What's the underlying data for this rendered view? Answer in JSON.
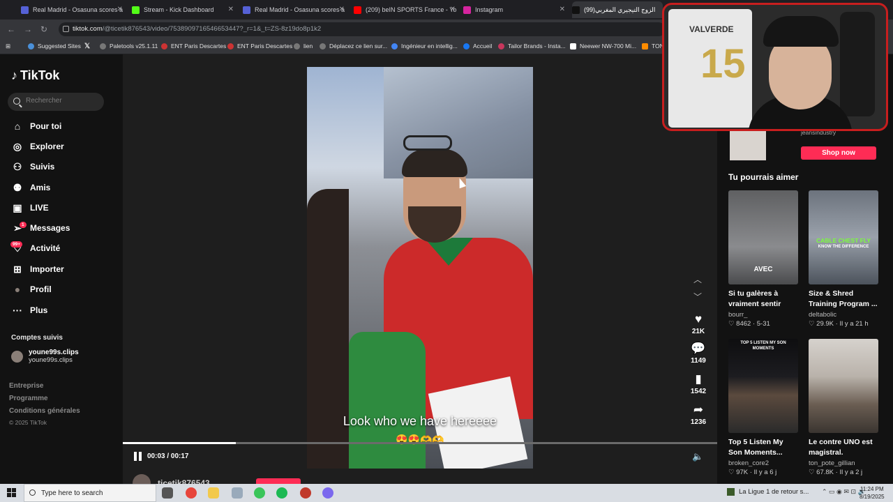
{
  "browser": {
    "tabs": [
      {
        "title": "Real Madrid - Osasuna scores a",
        "color": "#5561d6"
      },
      {
        "title": "Stream - Kick Dashboard",
        "color": "#53fc18"
      },
      {
        "title": "Real Madrid - Osasuna scores a",
        "color": "#5561d6"
      },
      {
        "title": "(209) beIN SPORTS France - Yo",
        "color": "#ff0000"
      },
      {
        "title": "Instagram",
        "color": "#d6249f"
      },
      {
        "title": "(99)الزوج التيجيري المغربي",
        "color": "#111111"
      }
    ],
    "url_host": "tiktok.com",
    "url_path": "/@ticetik876543/video/7538909716546653447?_r=1&_t=ZS-8z19do8p1k2",
    "bookmarks": [
      "Suggested Sites",
      "",
      "Paletools v25.1.11",
      "ENT Paris Descartes",
      "ENT Paris Descartes",
      "lien",
      "Déplacez ce lien sur...",
      "Ingénieur en intellig...",
      "Accueil",
      "Tailor Brands - Insta...",
      "Neewer NW-700 Mi...",
      "TON"
    ]
  },
  "sidebar": {
    "logo": "TikTok",
    "search_placeholder": "Rechercher",
    "nav": [
      {
        "label": "Pour toi",
        "icon": "home-icon",
        "glyph": "⌂"
      },
      {
        "label": "Explorer",
        "icon": "compass-icon",
        "glyph": "◎"
      },
      {
        "label": "Suivis",
        "icon": "following-icon",
        "glyph": "⚇"
      },
      {
        "label": "Amis",
        "icon": "friends-icon",
        "glyph": "⚉"
      },
      {
        "label": "LIVE",
        "icon": "live-icon",
        "glyph": "▣"
      },
      {
        "label": "Messages",
        "icon": "messages-icon",
        "glyph": "➢",
        "badge": "1"
      },
      {
        "label": "Activité",
        "icon": "activity-icon",
        "glyph": "♡",
        "badge": "99+"
      },
      {
        "label": "Importer",
        "icon": "upload-icon",
        "glyph": "⊞"
      },
      {
        "label": "Profil",
        "icon": "profile-icon",
        "glyph": "●"
      },
      {
        "label": "Plus",
        "icon": "more-icon",
        "glyph": "···"
      }
    ],
    "followed_title": "Comptes suivis",
    "followed": [
      {
        "name": "youne99s.clips",
        "handle": "youne99s.clips"
      }
    ],
    "footer": [
      "Entreprise",
      "Programme",
      "Conditions générales"
    ],
    "copyright": "© 2025 TikTok"
  },
  "video": {
    "caption": "Look who we have hereeee",
    "emojis": "😍😍🫶🫶",
    "time": "00:03 / 00:17",
    "progress": 0.19,
    "likes": "21K",
    "comments": "1149",
    "saves": "1542",
    "shares": "1236",
    "author": "ticetik876543"
  },
  "right": {
    "ad_account": "jeansindustry",
    "shop_label": "Shop now",
    "might_like": "Tu pourrais aimer",
    "cards": [
      {
        "title": "Si tu galères à vraiment sentir tes...",
        "author": "bourr_",
        "likes": "8462",
        "date": "5-31",
        "overlay": "AVEC",
        "bg": "#6d6e70",
        "overlay_color": "#ffffff"
      },
      {
        "title": "Size & Shred Training Program ...",
        "author": "deltabolic",
        "likes": "29.9K",
        "date": "Il y a 21 h",
        "overlay": "CABLE CHEST FLY",
        "overlay2": "KNOW THE DIFFERENCE",
        "bg": "#7d8590",
        "overlay_color": "#7cff3c"
      },
      {
        "title": "Top 5 Listen My Son Moments...",
        "author": "broken_core2",
        "likes": "97K",
        "date": "Il y a 6 j",
        "overlay": "TOP 5 LISTEN MY SON MOMENTS",
        "bg": "#141414",
        "overlay_color": "#ffffff"
      },
      {
        "title": "Le contre UNO est magistral. #pourtoi...",
        "author": "ton_pote_gillian",
        "likes": "67.8K",
        "date": "Il y a 2 j",
        "overlay": "",
        "bg": "#c9c4bf",
        "overlay_color": "#ffffff"
      }
    ]
  },
  "webcam": {
    "jersey_name": "VALVERDE",
    "jersey_number": "15"
  },
  "taskbar": {
    "search_placeholder": "Type here to search",
    "news": "La Ligue 1 de retour s...",
    "time": "11:24 PM",
    "date": "8/19/2025"
  }
}
